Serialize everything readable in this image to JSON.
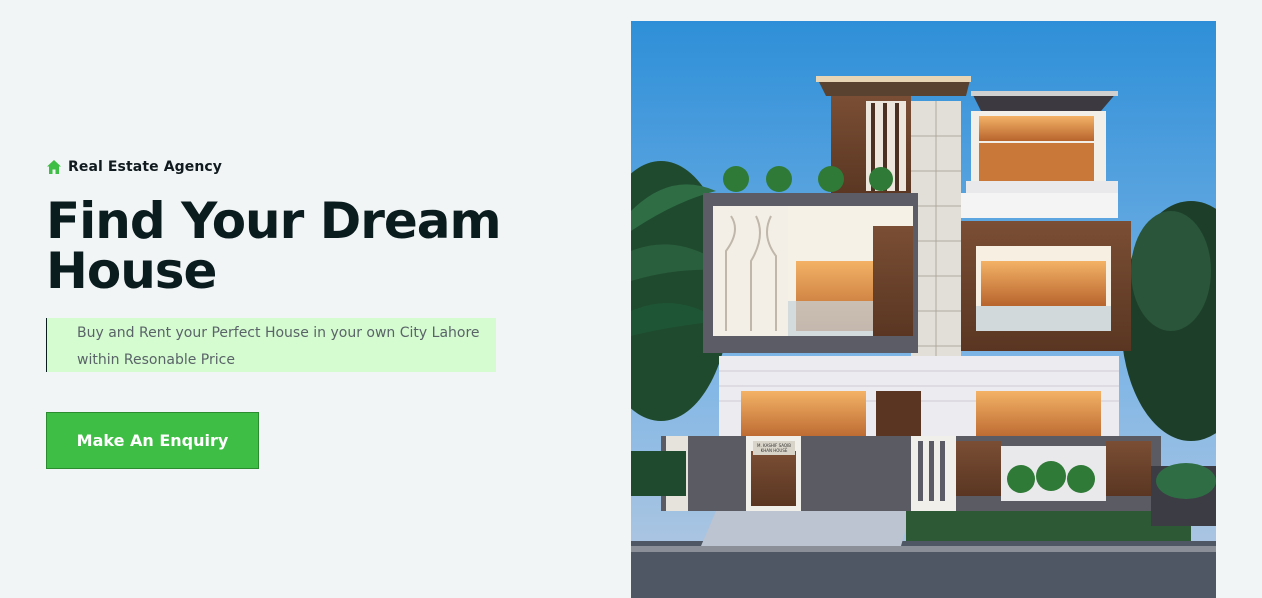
{
  "hero": {
    "eyebrow": {
      "icon": "home-icon",
      "label": "Real Estate Agency"
    },
    "title": "Find Your Dream House",
    "tagline": "Buy and Rent your Perfect House in your own City Lahore within Resonable Price",
    "cta_label": "Make An Enquiry"
  },
  "image": {
    "sign_lines": [
      "M. KASHIF SAQIB",
      "KHAN HOUSE"
    ]
  },
  "colors": {
    "accent": "#3ebe44",
    "heading": "#0b1c1f",
    "highlight": "#d5fbd0",
    "background": "#f1f5f6"
  }
}
